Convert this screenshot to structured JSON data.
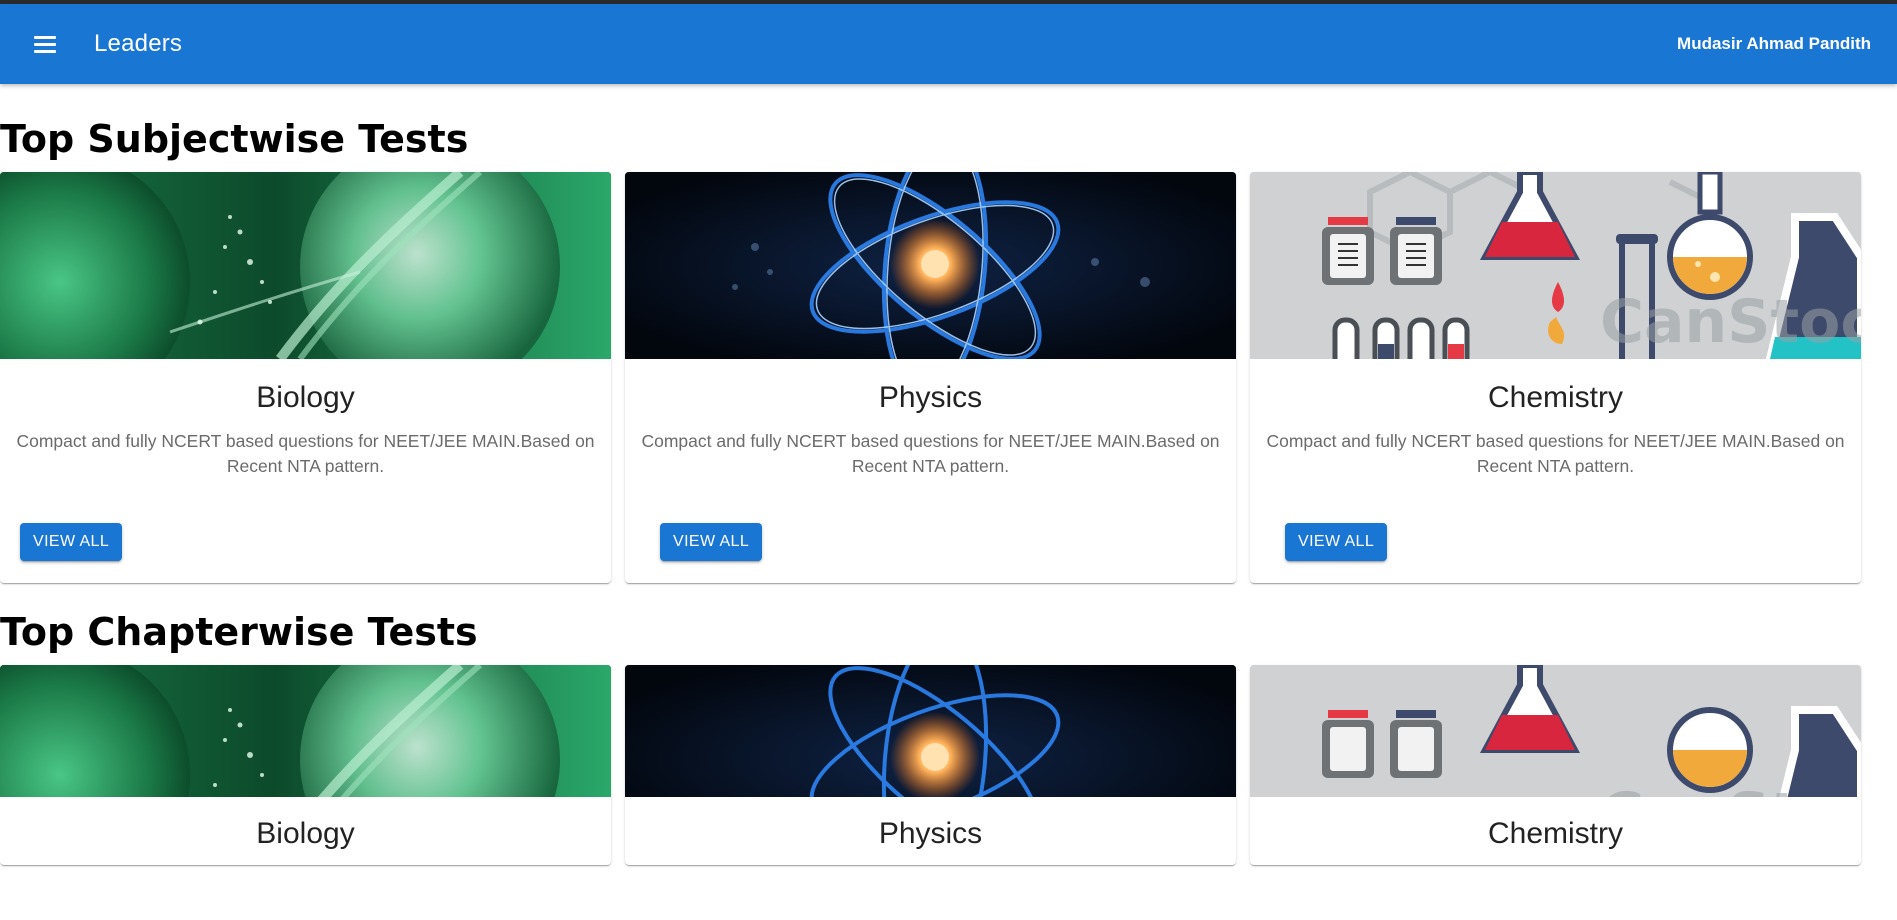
{
  "appbar": {
    "title": "Leaders",
    "user_name": "Mudasir Ahmad Pandith",
    "menu_icon": "menu-icon",
    "background_color": "#1976d2"
  },
  "sections": [
    {
      "title": "Top Subjectwise Tests",
      "cards": [
        {
          "title": "Biology",
          "description": "Compact and fully NCERT based questions for NEET/JEE MAIN.Based on Recent NTA pattern.",
          "button": "VIEW ALL",
          "image": "biology-dna-cell-image"
        },
        {
          "title": "Physics",
          "description": "Compact and fully NCERT based questions for NEET/JEE MAIN.Based on Recent NTA pattern.",
          "button": "VIEW ALL",
          "image": "physics-atom-image"
        },
        {
          "title": "Chemistry",
          "description": "Compact and fully NCERT based questions for NEET/JEE MAIN.Based on Recent NTA pattern.",
          "button": "VIEW ALL",
          "image": "chemistry-flasks-image"
        }
      ]
    },
    {
      "title": "Top Chapterwise Tests",
      "cards": [
        {
          "title": "Biology",
          "image": "biology-dna-cell-image"
        },
        {
          "title": "Physics",
          "image": "physics-atom-image"
        },
        {
          "title": "Chemistry",
          "image": "chemistry-flasks-image"
        }
      ]
    }
  ],
  "watermark": "CanStock"
}
